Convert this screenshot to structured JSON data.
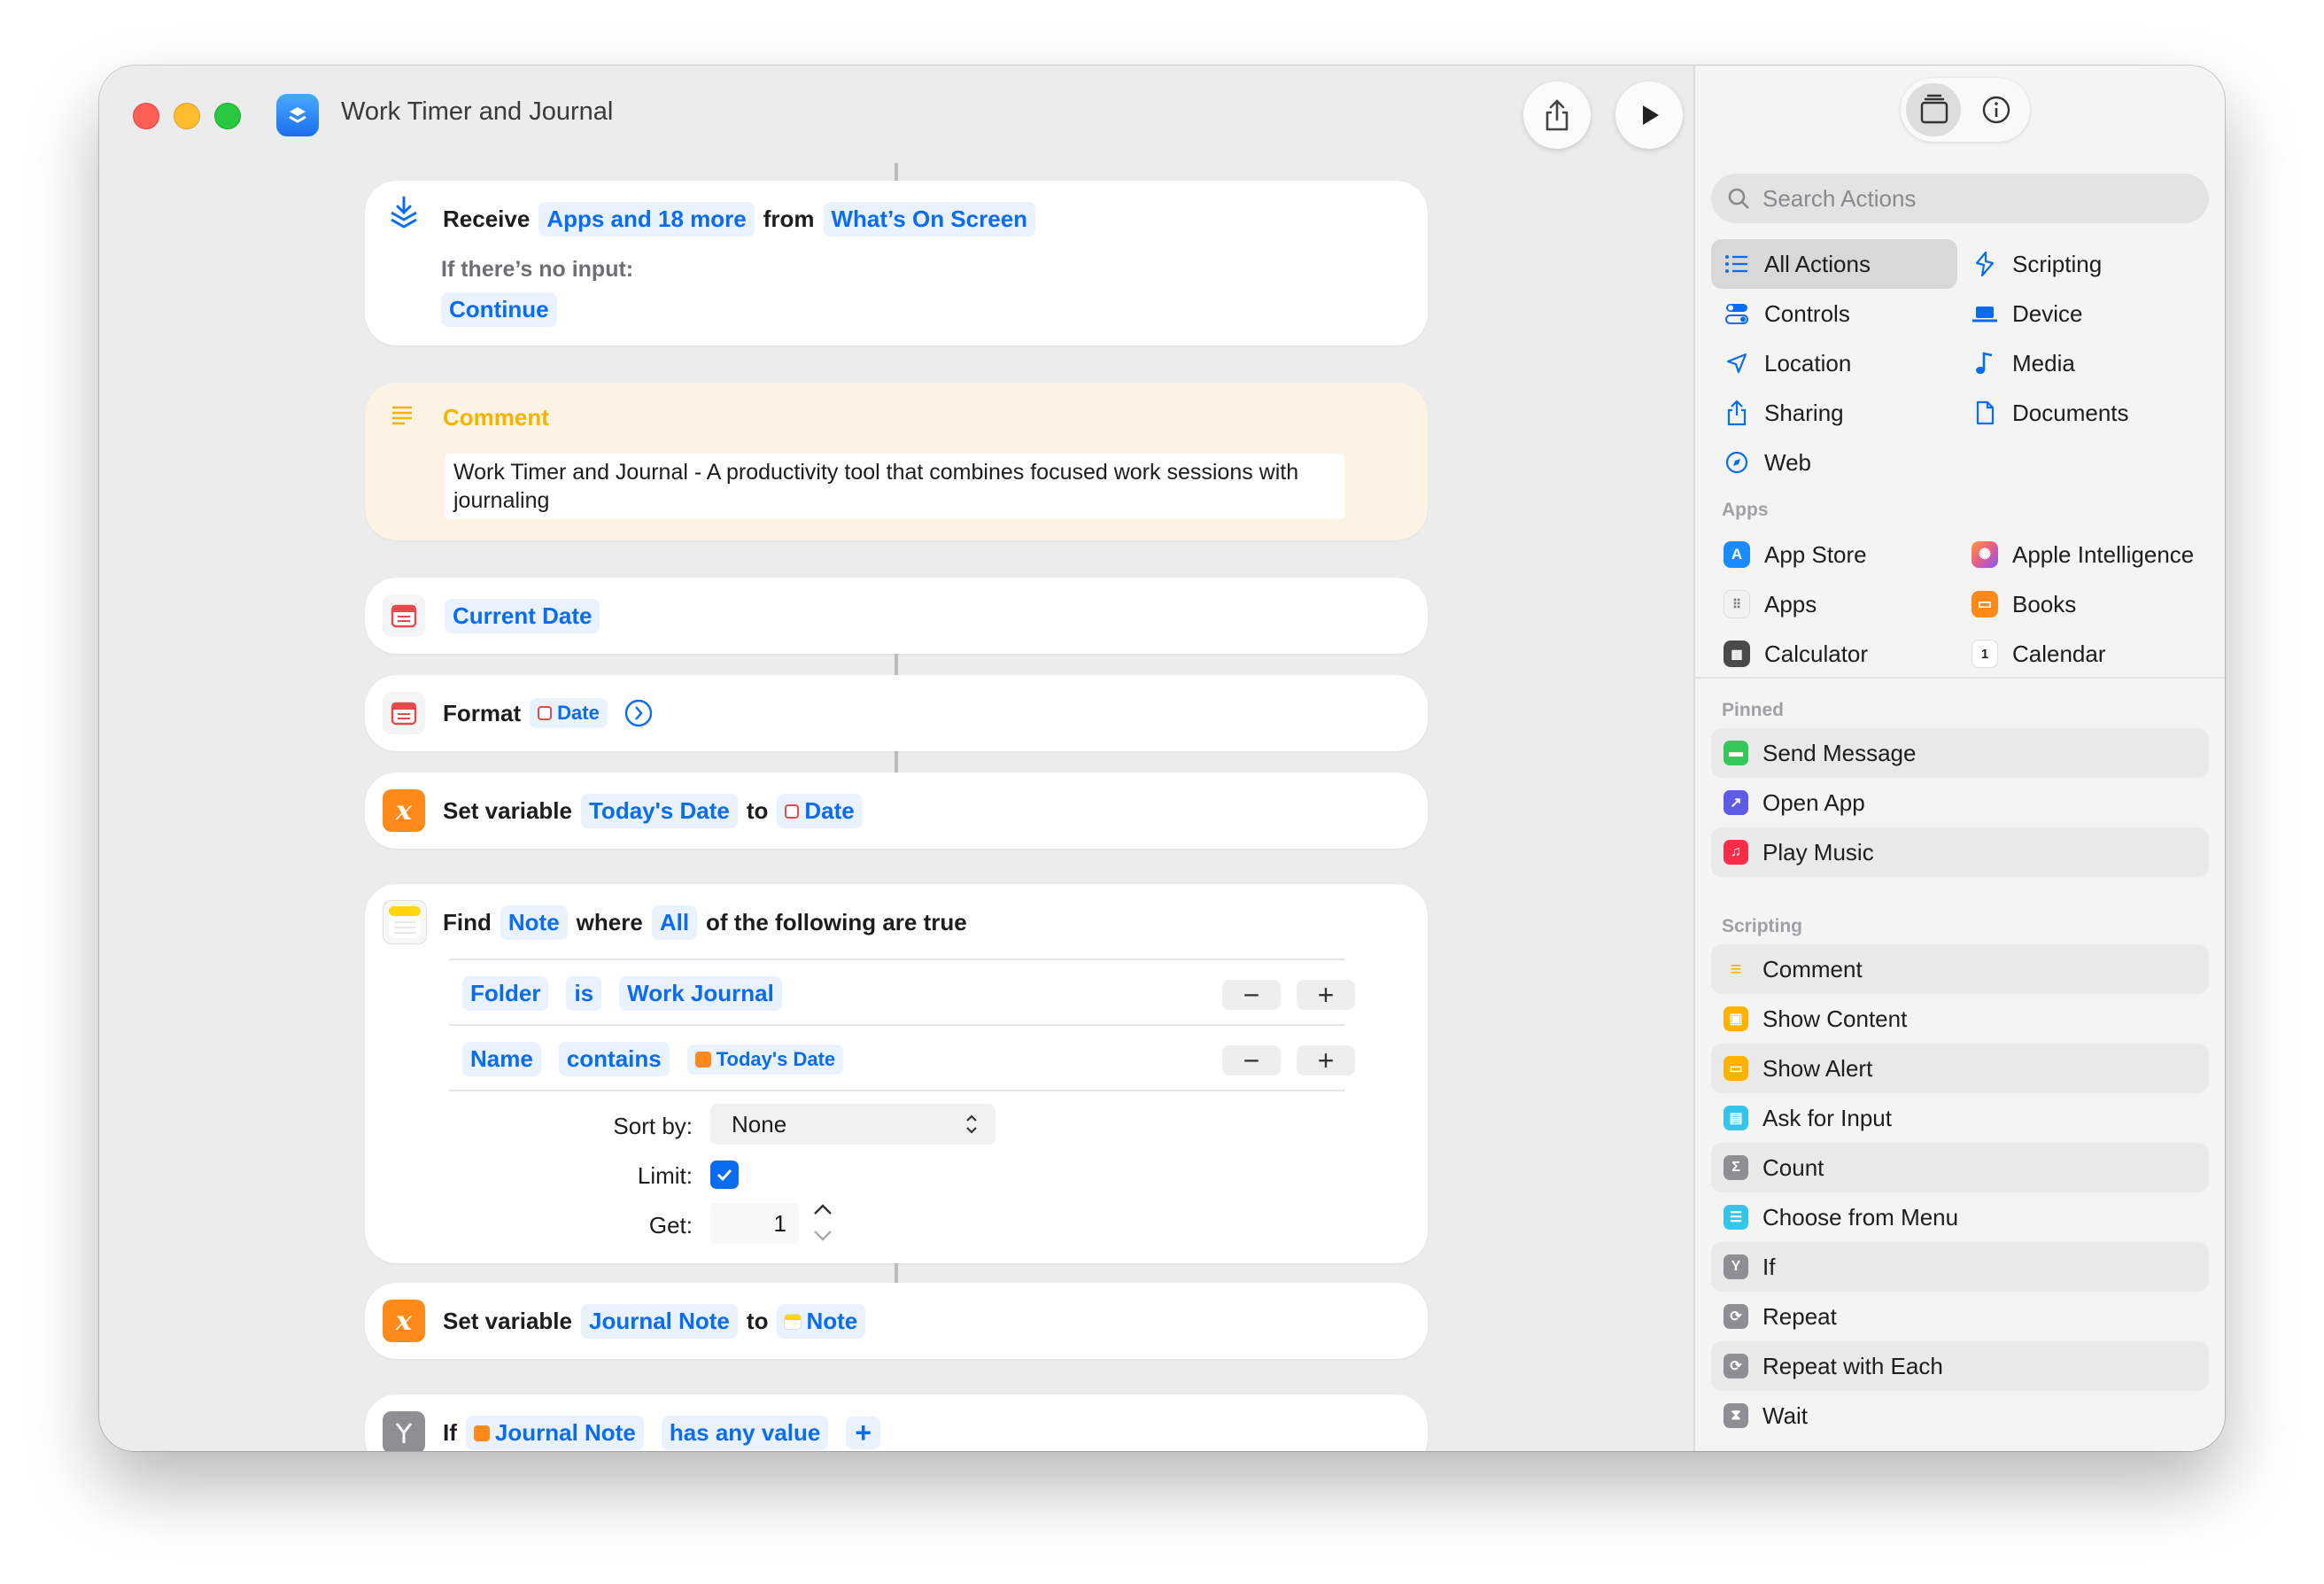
{
  "window": {
    "title": "Work Timer and Journal"
  },
  "actions": {
    "receive": {
      "verb": "Receive",
      "types": "Apps and 18 more",
      "from": "from",
      "source": "What’s On Screen",
      "no_input_label": "If there’s no input:",
      "no_input_value": "Continue"
    },
    "comment": {
      "title": "Comment",
      "text": "Work Timer and Journal - A productivity tool that combines focused work sessions with journaling"
    },
    "current_date": {
      "label": "Current Date"
    },
    "format": {
      "verb": "Format",
      "param": "Date"
    },
    "set_var1": {
      "verb": "Set variable",
      "name": "Today's Date",
      "to": "to",
      "value": "Date"
    },
    "find": {
      "verb": "Find",
      "type": "Note",
      "where": "where",
      "quantifier": "All",
      "suffix": "of the following are true",
      "filters": [
        {
          "field": "Folder",
          "op": "is",
          "value": "Work Journal"
        },
        {
          "field": "Name",
          "op": "contains",
          "value": "Today's Date"
        }
      ],
      "sort_label": "Sort by:",
      "sort_value": "None",
      "limit_label": "Limit:",
      "limit_checked": true,
      "get_label": "Get:",
      "get_value": "1"
    },
    "set_var2": {
      "verb": "Set variable",
      "name": "Journal Note",
      "to": "to",
      "value": "Note"
    },
    "if": {
      "verb": "If",
      "input": "Journal Note",
      "condition": "has any value"
    }
  },
  "sidebar": {
    "search_placeholder": "Search Actions",
    "categories": [
      {
        "label": "All Actions",
        "icon": "list-icon",
        "active": true
      },
      {
        "label": "Scripting",
        "icon": "scripting-icon"
      },
      {
        "label": "Controls",
        "icon": "toggles-icon"
      },
      {
        "label": "Device",
        "icon": "laptop-icon"
      },
      {
        "label": "Location",
        "icon": "location-arrow-icon"
      },
      {
        "label": "Media",
        "icon": "music-note-icon"
      },
      {
        "label": "Sharing",
        "icon": "share-icon"
      },
      {
        "label": "Documents",
        "icon": "document-icon"
      },
      {
        "label": "Web",
        "icon": "compass-icon"
      }
    ],
    "apps_header": "Apps",
    "apps": [
      {
        "label": "App Store",
        "icon": "app-store-icon",
        "color": "#1a8cff"
      },
      {
        "label": "Apple Intelligence",
        "icon": "apple-intelligence-icon",
        "color": "#e85a8a"
      },
      {
        "label": "Apps",
        "icon": "apps-grid-icon",
        "color": "#f2f2f2"
      },
      {
        "label": "Books",
        "icon": "books-icon",
        "color": "#ff8a1a"
      },
      {
        "label": "Calculator",
        "icon": "calculator-icon",
        "color": "#4a4a4a"
      },
      {
        "label": "Calendar",
        "icon": "calendar-icon",
        "color": "#ffffff"
      }
    ],
    "pinned_header": "Pinned",
    "pinned": [
      {
        "label": "Send Message",
        "icon": "message-icon",
        "color": "#34c759"
      },
      {
        "label": "Open App",
        "icon": "open-app-icon",
        "color": "#5e5ce6"
      },
      {
        "label": "Play Music",
        "icon": "music-icon",
        "color": "#fa2d48"
      }
    ],
    "scripting_header": "Scripting",
    "scripting": [
      {
        "label": "Comment",
        "icon": "comment-lines-icon",
        "color": "#ffcc00"
      },
      {
        "label": "Show Content",
        "icon": "show-content-icon",
        "color": "#ffb300"
      },
      {
        "label": "Show Alert",
        "icon": "show-alert-icon",
        "color": "#ffb300"
      },
      {
        "label": "Ask for Input",
        "icon": "ask-input-icon",
        "color": "#33c6e8"
      },
      {
        "label": "Count",
        "icon": "sigma-icon",
        "color": "#8e8e93"
      },
      {
        "label": "Choose from Menu",
        "icon": "menu-icon",
        "color": "#33c6e8"
      },
      {
        "label": "If",
        "icon": "branch-icon",
        "color": "#8e8e93"
      },
      {
        "label": "Repeat",
        "icon": "repeat-icon",
        "color": "#8e8e93"
      },
      {
        "label": "Repeat with Each",
        "icon": "repeat-each-icon",
        "color": "#8e8e93"
      },
      {
        "label": "Wait",
        "icon": "hourglass-icon",
        "color": "#8e8e93"
      }
    ]
  }
}
